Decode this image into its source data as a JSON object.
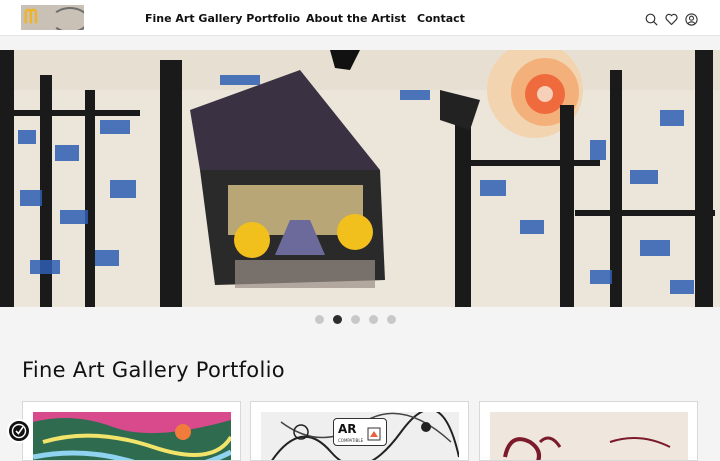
{
  "nav": {
    "items": [
      {
        "label": "Fine Art Gallery Portfolio"
      },
      {
        "label": "About the Artist"
      },
      {
        "label": "Contact"
      }
    ]
  },
  "icons": [
    "search-icon",
    "heart-icon",
    "user-icon"
  ],
  "carousel": {
    "slide_count": 5,
    "active_index": 1
  },
  "section": {
    "title": "Fine Art Gallery Portfolio"
  },
  "ar_badge": {
    "label": "AR",
    "sublabel": "COMPATIBLE"
  },
  "colors": {
    "accent": "#2d2d2d",
    "logo_mark": "#f0b323"
  }
}
